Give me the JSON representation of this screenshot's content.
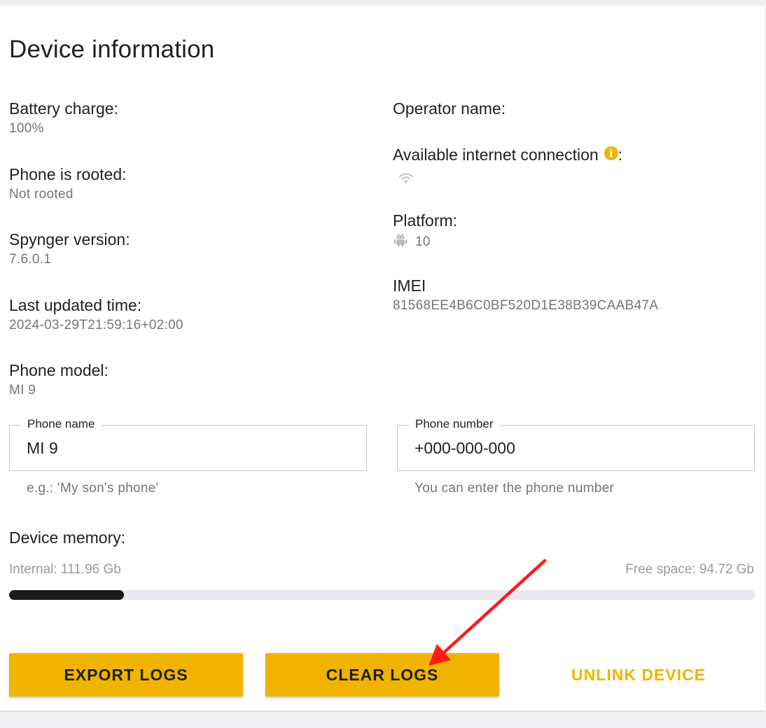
{
  "page": {
    "title": "Device information"
  },
  "left_info": [
    {
      "label": "Battery charge:",
      "value": "100%"
    },
    {
      "label": "Phone is rooted:",
      "value": "Not rooted"
    },
    {
      "label": "Spynger version:",
      "value": "7.6.0.1"
    },
    {
      "label": "Last updated time:",
      "value": "2024-03-29T21:59:16+02:00"
    },
    {
      "label": "Phone model:",
      "value": "MI 9"
    }
  ],
  "right_info": {
    "operator": {
      "label": "Operator name:",
      "value": ""
    },
    "internet": {
      "label": "Available internet connection",
      "suffix": ":",
      "info_badge": "i",
      "icon": "wifi-icon"
    },
    "platform": {
      "label": "Platform:",
      "value": "10",
      "icon": "android-icon"
    },
    "imei": {
      "label": "IMEI",
      "value": "81568EE4B6C0BF520D1E38B39CAAB47A"
    }
  },
  "fields": {
    "phone_name": {
      "label": "Phone name",
      "value": "MI 9",
      "hint": "e.g.: 'My son's phone'"
    },
    "phone_number": {
      "label": "Phone number",
      "value": "+000-000-000",
      "hint": "You can enter the phone number"
    }
  },
  "memory": {
    "label": "Device memory:",
    "internal": "Internal: 111.96 Gb",
    "free": "Free space: 94.72 Gb",
    "used_fraction": 0.154
  },
  "buttons": {
    "export": "EXPORT LOGS",
    "clear": "CLEAR LOGS",
    "unlink": "UNLINK DEVICE"
  },
  "colors": {
    "accent": "#f0b400",
    "annotation_arrow": "#ff1a1a",
    "progress_fill": "#1c1c1c",
    "progress_track": "#e8e9ee"
  }
}
